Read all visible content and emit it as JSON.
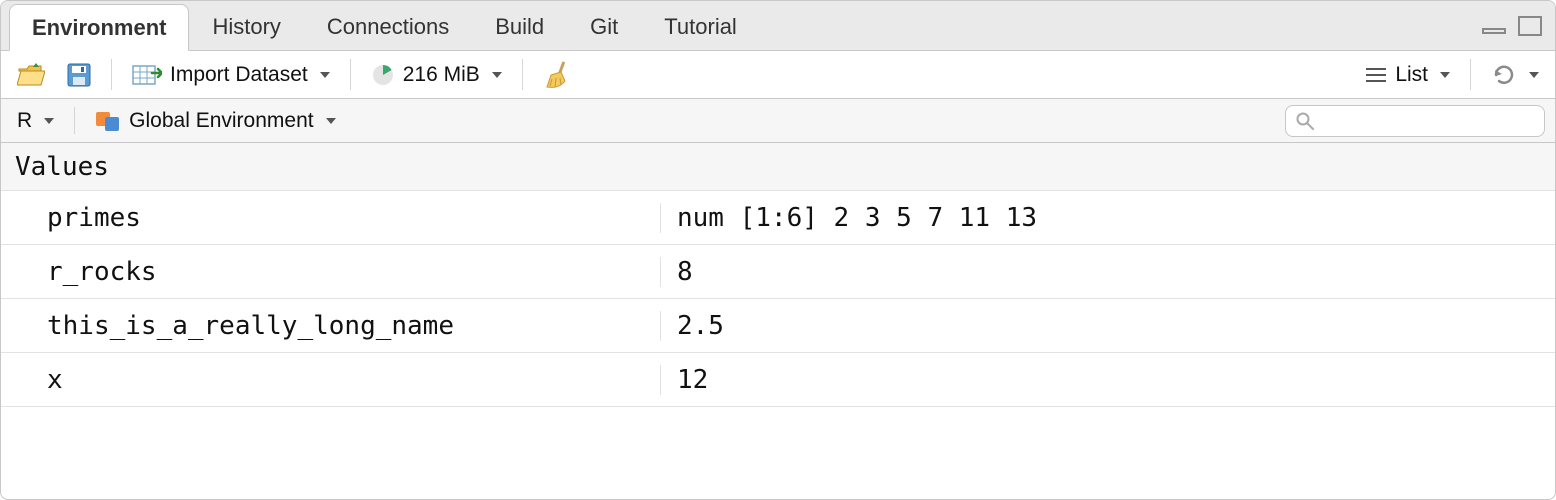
{
  "tabs": [
    {
      "label": "Environment",
      "active": true
    },
    {
      "label": "History",
      "active": false
    },
    {
      "label": "Connections",
      "active": false
    },
    {
      "label": "Build",
      "active": false
    },
    {
      "label": "Git",
      "active": false
    },
    {
      "label": "Tutorial",
      "active": false
    }
  ],
  "toolbar": {
    "import_dataset_label": "Import Dataset",
    "memory_label": "216 MiB",
    "view_label": "List"
  },
  "toolbar2": {
    "engine_label": "R",
    "scope_label": "Global Environment",
    "search_placeholder": ""
  },
  "section_header": "Values",
  "variables": [
    {
      "name": "primes",
      "value": "num [1:6] 2 3 5 7 11 13"
    },
    {
      "name": "r_rocks",
      "value": "8"
    },
    {
      "name": "this_is_a_really_long_name",
      "value": "2.5"
    },
    {
      "name": "x",
      "value": "12"
    }
  ]
}
